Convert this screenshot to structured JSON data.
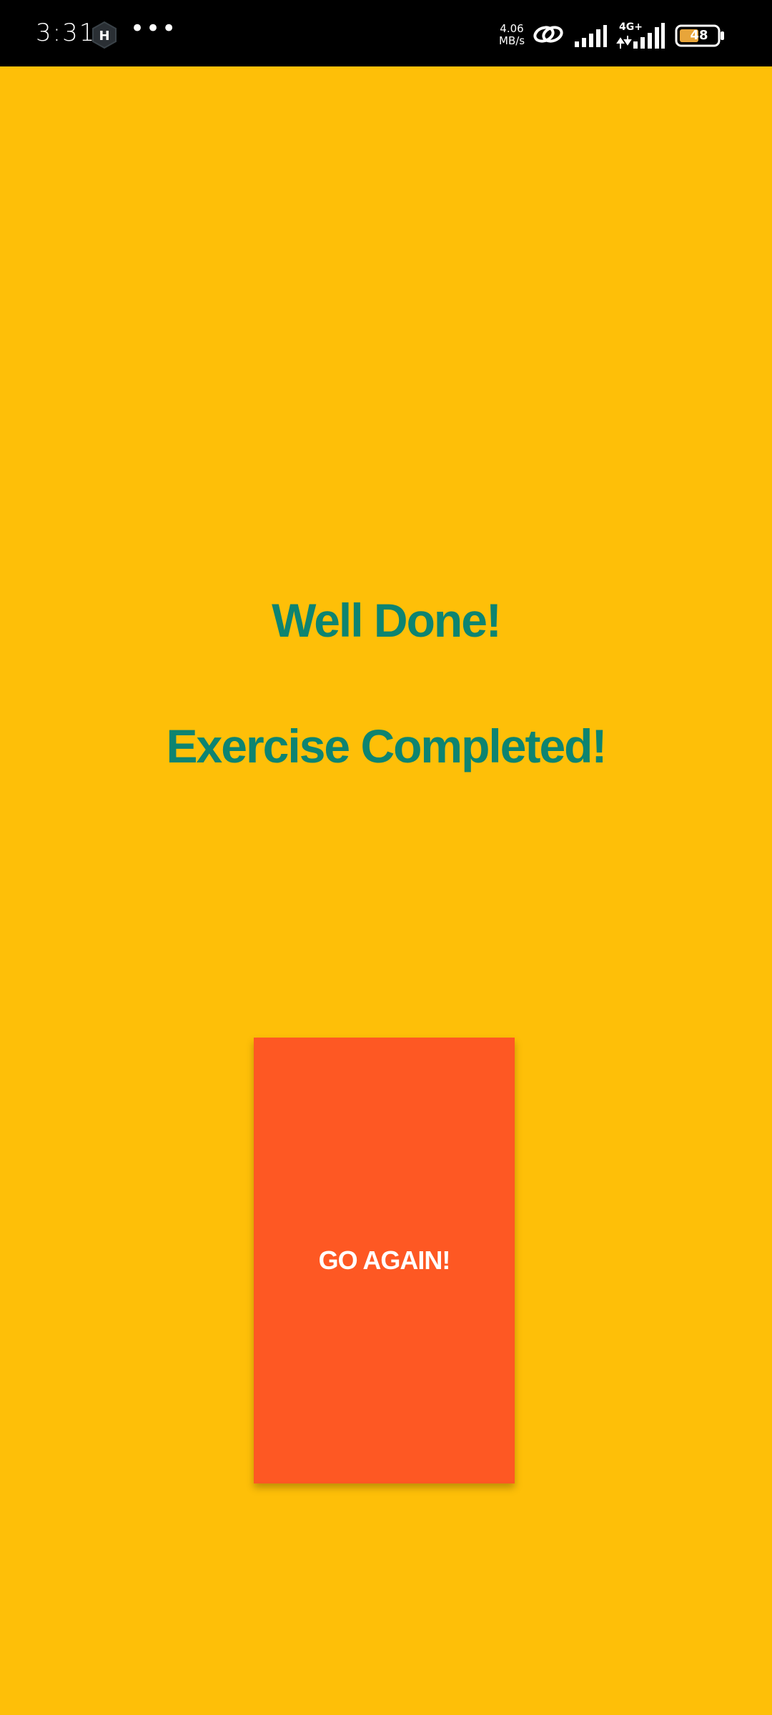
{
  "status_bar": {
    "time": "3:31",
    "more": "•••",
    "net_speed_value": "4.06",
    "net_speed_unit": "MB/s",
    "network_type": "4G+",
    "battery_level": "48",
    "icons": [
      "app-hexagon-icon",
      "link-icon",
      "signal-icon",
      "signal-4g-icon",
      "battery-icon"
    ]
  },
  "main": {
    "title": "Well Done!",
    "subtitle": "Exercise Completed!",
    "button_label": "GO AGAIN!"
  },
  "colors": {
    "background": "#FEBF08",
    "text_teal": "#0D8471",
    "button_orange": "#FE5823"
  }
}
